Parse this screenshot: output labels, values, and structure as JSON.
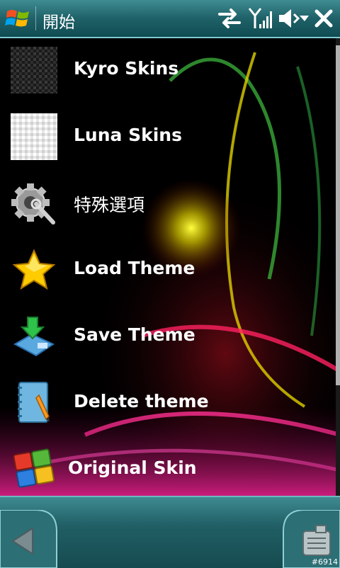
{
  "title_bar": {
    "title": "開始",
    "start_button": "windows-start-icon",
    "status_icons": [
      "connectivity-arrows-icon",
      "signal-strength-icon",
      "volume-icon",
      "close-icon"
    ]
  },
  "menu": {
    "items": [
      {
        "label": "Kyro Skins",
        "icon": "carbon-texture-icon"
      },
      {
        "label": "Luna Skins",
        "icon": "white-texture-icon"
      },
      {
        "label": "特殊選項",
        "icon": "settings-gear-icon"
      },
      {
        "label": "Load Theme",
        "icon": "star-icon"
      },
      {
        "label": "Save Theme",
        "icon": "save-download-icon"
      },
      {
        "label": "Delete theme",
        "icon": "notebook-pencil-icon"
      },
      {
        "label": "Original Skin",
        "icon": "windows-squares-icon"
      }
    ]
  },
  "bottom_bar": {
    "left_softkey": "back-arrow-icon",
    "right_softkey": "menu-list-icon"
  },
  "watermark": "#6914"
}
